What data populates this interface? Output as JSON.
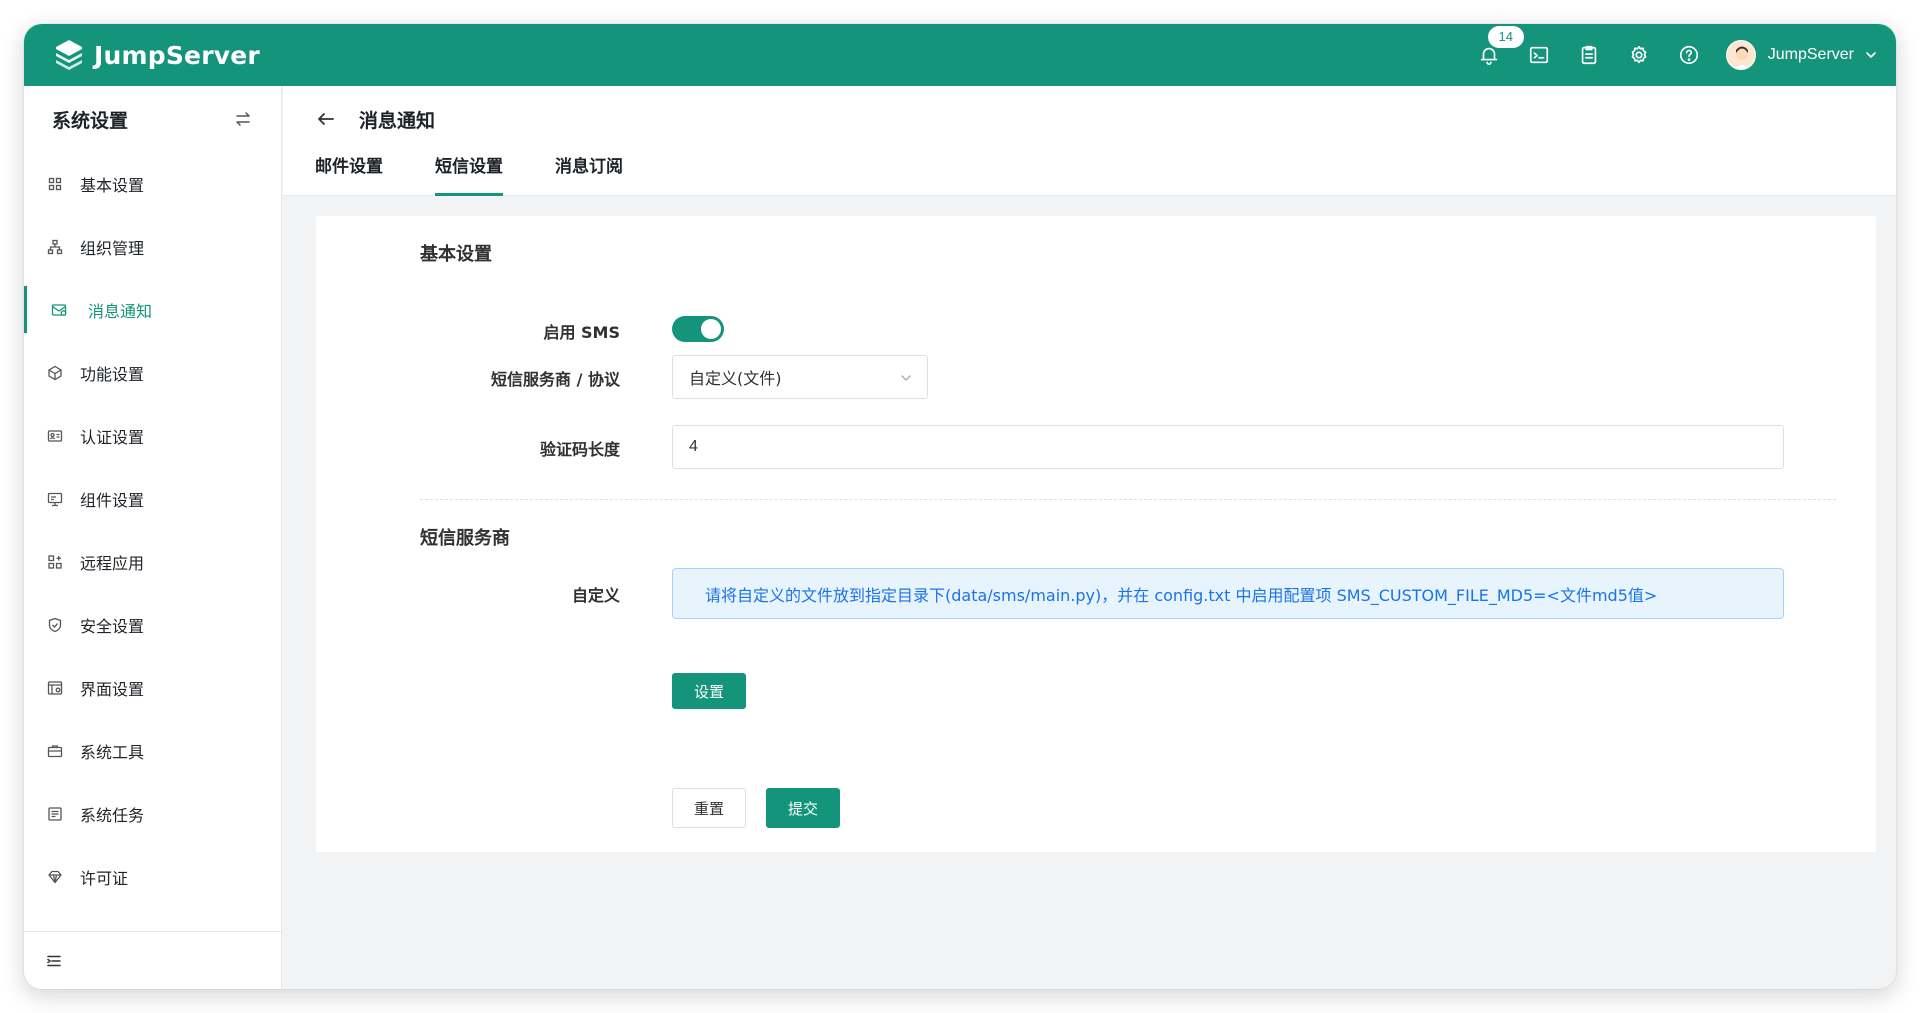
{
  "app": {
    "brand": "JumpServer",
    "accent": "#14947a"
  },
  "header": {
    "notification_count": "14",
    "icons": [
      "bell-icon",
      "terminal-icon",
      "clipboard-icon",
      "gear-icon",
      "help-icon"
    ],
    "user_name": "JumpServer"
  },
  "sidebar": {
    "title": "系统设置",
    "items": [
      {
        "label": "基本设置",
        "icon": "grid-icon"
      },
      {
        "label": "组织管理",
        "icon": "org-tree-icon"
      },
      {
        "label": "消息通知",
        "icon": "message-icon",
        "active": true
      },
      {
        "label": "功能设置",
        "icon": "cube-icon"
      },
      {
        "label": "认证设置",
        "icon": "id-card-icon"
      },
      {
        "label": "组件设置",
        "icon": "monitor-icon"
      },
      {
        "label": "远程应用",
        "icon": "apps-icon"
      },
      {
        "label": "安全设置",
        "icon": "shield-icon"
      },
      {
        "label": "界面设置",
        "icon": "interface-icon"
      },
      {
        "label": "系统工具",
        "icon": "toolbox-icon"
      },
      {
        "label": "系统任务",
        "icon": "task-list-icon"
      },
      {
        "label": "许可证",
        "icon": "license-icon"
      }
    ]
  },
  "page": {
    "title": "消息通知",
    "tabs": [
      {
        "label": "邮件设置"
      },
      {
        "label": "短信设置",
        "active": true
      },
      {
        "label": "消息订阅"
      }
    ]
  },
  "form": {
    "basic_section_title": "基本设置",
    "enable_sms_label": "启用 SMS",
    "enable_sms_value": true,
    "provider_label": "短信服务商 / 协议",
    "provider_value": "自定义(文件)",
    "code_length_label": "验证码长度",
    "code_length_value": "4",
    "provider_section_title": "短信服务商",
    "custom_label": "自定义",
    "custom_info": "请将自定义的文件放到指定目录下(data/sms/main.py)，并在 config.txt 中启用配置项 SMS_CUSTOM_FILE_MD5=<文件md5值>",
    "setup_button": "设置",
    "reset_button": "重置",
    "submit_button": "提交"
  }
}
